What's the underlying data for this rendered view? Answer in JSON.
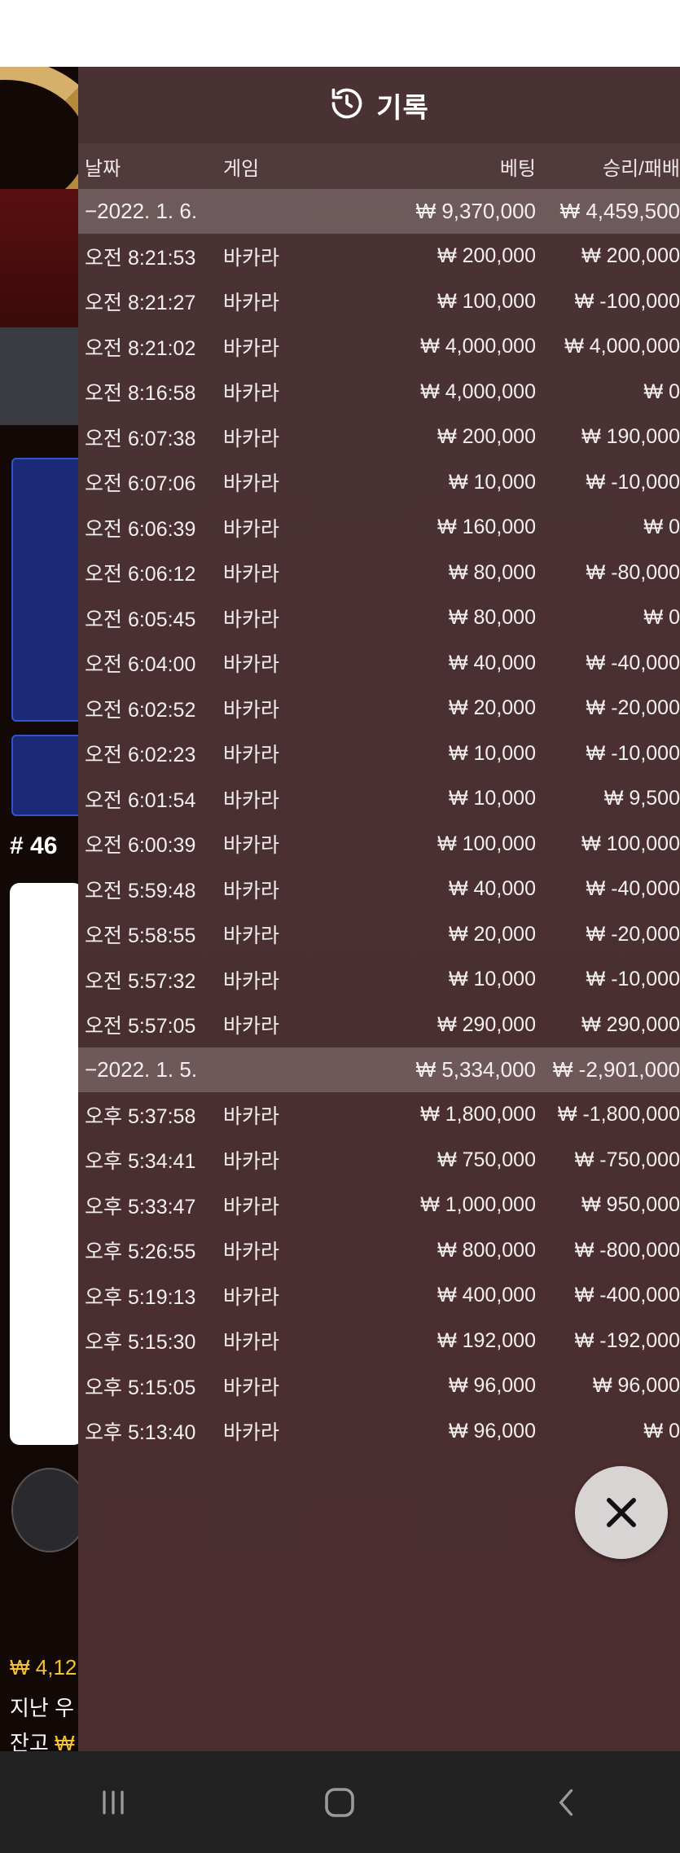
{
  "panel": {
    "title": "기록",
    "icon": "history-icon"
  },
  "columns": {
    "date": "날짜",
    "game": "게임",
    "bet": "베팅",
    "result": "승리/패배"
  },
  "groups": [
    {
      "date": "−2022. 1. 6.",
      "total_bet": "₩ 9,370,000",
      "total_result": "₩ 4,459,500",
      "rows": [
        {
          "time": "오전 8:21:53",
          "game": "바카라",
          "bet": "₩ 200,000",
          "result": "₩ 200,000"
        },
        {
          "time": "오전 8:21:27",
          "game": "바카라",
          "bet": "₩ 100,000",
          "result": "₩ -100,000"
        },
        {
          "time": "오전 8:21:02",
          "game": "바카라",
          "bet": "₩ 4,000,000",
          "result": "₩ 4,000,000"
        },
        {
          "time": "오전 8:16:58",
          "game": "바카라",
          "bet": "₩ 4,000,000",
          "result": "₩ 0"
        },
        {
          "time": "오전 6:07:38",
          "game": "바카라",
          "bet": "₩ 200,000",
          "result": "₩ 190,000"
        },
        {
          "time": "오전 6:07:06",
          "game": "바카라",
          "bet": "₩ 10,000",
          "result": "₩ -10,000"
        },
        {
          "time": "오전 6:06:39",
          "game": "바카라",
          "bet": "₩ 160,000",
          "result": "₩ 0"
        },
        {
          "time": "오전 6:06:12",
          "game": "바카라",
          "bet": "₩ 80,000",
          "result": "₩ -80,000"
        },
        {
          "time": "오전 6:05:45",
          "game": "바카라",
          "bet": "₩ 80,000",
          "result": "₩ 0"
        },
        {
          "time": "오전 6:04:00",
          "game": "바카라",
          "bet": "₩ 40,000",
          "result": "₩ -40,000"
        },
        {
          "time": "오전 6:02:52",
          "game": "바카라",
          "bet": "₩ 20,000",
          "result": "₩ -20,000"
        },
        {
          "time": "오전 6:02:23",
          "game": "바카라",
          "bet": "₩ 10,000",
          "result": "₩ -10,000"
        },
        {
          "time": "오전 6:01:54",
          "game": "바카라",
          "bet": "₩ 10,000",
          "result": "₩ 9,500"
        },
        {
          "time": "오전 6:00:39",
          "game": "바카라",
          "bet": "₩ 100,000",
          "result": "₩ 100,000"
        },
        {
          "time": "오전 5:59:48",
          "game": "바카라",
          "bet": "₩ 40,000",
          "result": "₩ -40,000"
        },
        {
          "time": "오전 5:58:55",
          "game": "바카라",
          "bet": "₩ 20,000",
          "result": "₩ -20,000"
        },
        {
          "time": "오전 5:57:32",
          "game": "바카라",
          "bet": "₩ 10,000",
          "result": "₩ -10,000"
        },
        {
          "time": "오전 5:57:05",
          "game": "바카라",
          "bet": "₩ 290,000",
          "result": "₩ 290,000"
        }
      ]
    },
    {
      "date": "−2022. 1. 5.",
      "total_bet": "₩ 5,334,000",
      "total_result": "₩ -2,901,000",
      "rows": [
        {
          "time": "오후 5:37:58",
          "game": "바카라",
          "bet": "₩ 1,800,000",
          "result": "₩ -1,800,000"
        },
        {
          "time": "오후 5:34:41",
          "game": "바카라",
          "bet": "₩ 750,000",
          "result": "₩ -750,000"
        },
        {
          "time": "오후 5:33:47",
          "game": "바카라",
          "bet": "₩ 1,000,000",
          "result": "₩ 950,000"
        },
        {
          "time": "오후 5:26:55",
          "game": "바카라",
          "bet": "₩ 800,000",
          "result": "₩ -800,000"
        },
        {
          "time": "오후 5:19:13",
          "game": "바카라",
          "bet": "₩ 400,000",
          "result": "₩ -400,000"
        },
        {
          "time": "오후 5:15:30",
          "game": "바카라",
          "bet": "₩ 192,000",
          "result": "₩ -192,000"
        },
        {
          "time": "오후 5:15:05",
          "game": "바카라",
          "bet": "₩ 96,000",
          "result": "₩ 96,000"
        },
        {
          "time": "오후 5:13:40",
          "game": "바카라",
          "bet": "₩ 96,000",
          "result": "₩ 0"
        }
      ]
    }
  ],
  "background": {
    "round_label": "# 46",
    "balance_line": "₩ 4,12",
    "last_win_label": "지난 우",
    "last_win_value": "₩",
    "balance_label": "잔고",
    "balance_value": "₩"
  },
  "close_button": {
    "icon": "close-icon"
  },
  "navbar": {
    "recent": "recent-apps-icon",
    "home": "home-icon",
    "back": "back-icon"
  }
}
